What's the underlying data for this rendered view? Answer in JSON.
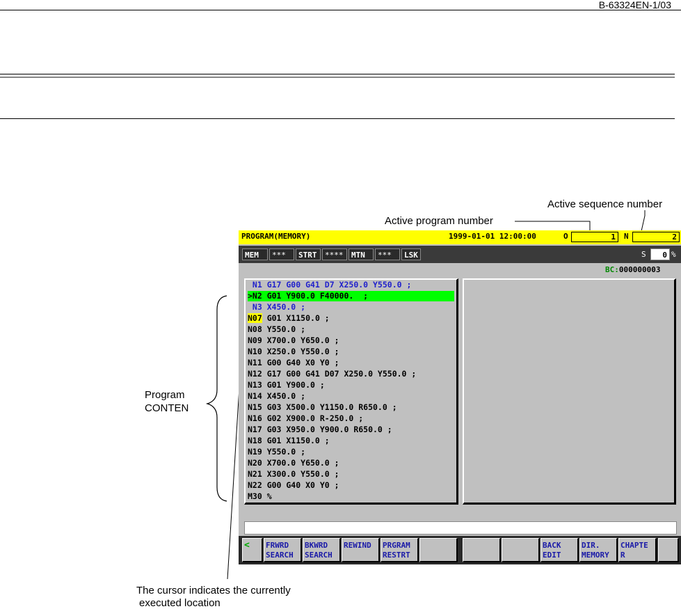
{
  "doc_id": "B-63324EN-1/03",
  "callouts": {
    "active_sequence_number": "Active sequence number",
    "active_program_number": "Active program number",
    "program_contents": [
      "Program",
      "CONTEN"
    ],
    "cursor_note": [
      "The cursor indicates the currently",
      "executed location"
    ]
  },
  "screen": {
    "title": "PROGRAM(MEMORY)",
    "datetime": "1999-01-01 12:00:00",
    "o_label": "O",
    "o_value": "1",
    "n_label": "N",
    "n_value": "2",
    "status": {
      "mode": "MEM",
      "s1": "***",
      "strt": "STRT",
      "s2": "****",
      "mtn": "MTN",
      "s3": "***",
      "lsk": "LSK",
      "s_label": "S",
      "s_value": "0",
      "pct": "%"
    },
    "bc_label": "BC:",
    "bc_value": "000000003",
    "program_lines": [
      " N1 G17 G00 G41 D7 X250.0 Y550.0 ;",
      ">N2 G01 Y900.0 F40000.  ;",
      " N3 X450.0 ;",
      "N07",
      " G01 X1150.0 ;",
      "N08 Y550.0 ;",
      "N09 X700.0 Y650.0 ;",
      "N10 X250.0 Y550.0 ;",
      "N11 G00 G40 X0 Y0 ;",
      "N12 G17 G00 G41 D07 X250.0 Y550.0 ;",
      "N13 G01 Y900.0 ;",
      "N14 X450.0 ;",
      "N15 G03 X500.0 Y1150.0 R650.0 ;",
      "N16 G02 X900.0 R-250.0 ;",
      "N17 G03 X950.0 Y900.0 R650.0 ;",
      "N18 G01 X1150.0 ;",
      "N19 Y550.0 ;",
      "N20 X700.0 Y650.0 ;",
      "N21 X300.0 Y550.0 ;",
      "N22 G00 G40 X0 Y0 ;",
      "M30 %"
    ],
    "softkeys": [
      "<",
      "FRWRD\nSEARCH",
      "BKWRD\nSEARCH",
      "REWIND",
      "PRGRAM\nRESTRT",
      "",
      "",
      "",
      "BACK\nEDIT",
      "DIR.\nMEMORY",
      "CHAPTE\nR",
      ""
    ]
  },
  "colors": {
    "title_bar": "#ffff00",
    "cursor_highlight": "#00ff00",
    "executed_text": "#2222cc",
    "softkey_text": "#1a1aa8",
    "bc_label": "#008800"
  }
}
